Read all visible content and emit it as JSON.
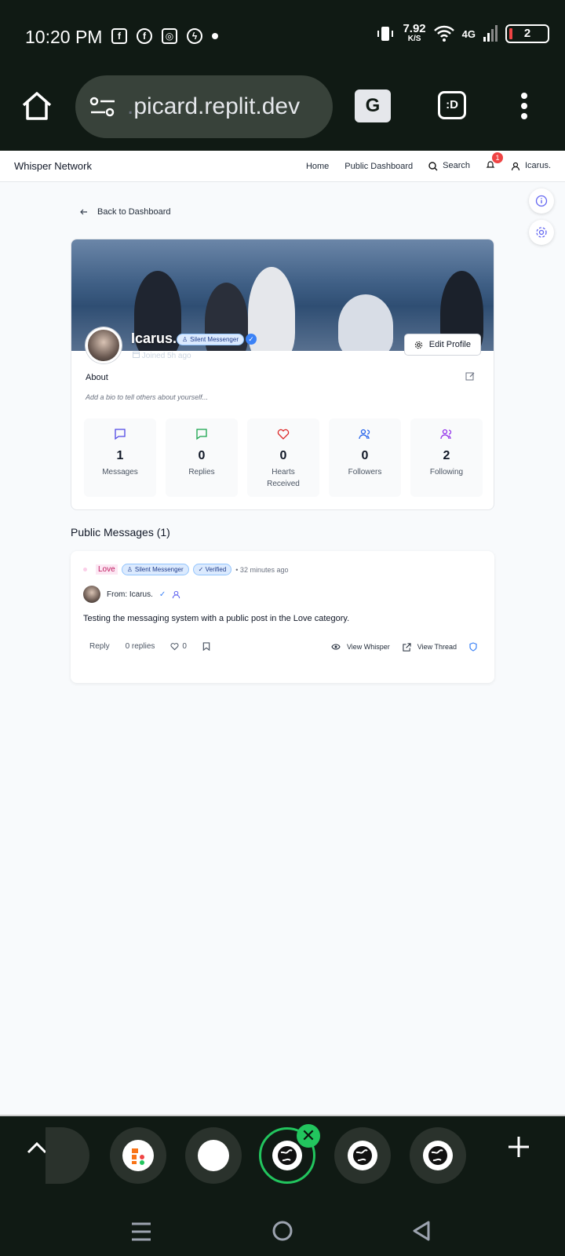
{
  "status_bar": {
    "time": "10:20 PM",
    "speed_value": "7.92",
    "speed_unit": "K/S",
    "network": "4G",
    "battery": "2"
  },
  "browser": {
    "url_prefix": ".",
    "url_domain": "picard.replit.dev",
    "tab_switch_label": ":D"
  },
  "navbar": {
    "brand": "Whisper Network",
    "home": "Home",
    "public_dashboard": "Public Dashboard",
    "search": "Search",
    "notification_count": "1",
    "user": "Icarus."
  },
  "back_link": "Back to Dashboard",
  "profile": {
    "name": "Icarus.",
    "badge": "Silent Messenger",
    "joined": "Joined 5h ago",
    "edit_button": "Edit Profile",
    "about_title": "About",
    "about_placeholder": "Add a bio to tell others about yourself...",
    "stats": [
      {
        "value": "1",
        "label": "Messages",
        "color": "#4f46e5",
        "icon": "message-square-icon"
      },
      {
        "value": "0",
        "label": "Replies",
        "color": "#16a34a",
        "icon": "message-reply-icon"
      },
      {
        "value": "0",
        "label": "Hearts Received",
        "color": "#dc2626",
        "icon": "heart-icon"
      },
      {
        "value": "0",
        "label": "Followers",
        "color": "#2563eb",
        "icon": "users-icon"
      },
      {
        "value": "2",
        "label": "Following",
        "color": "#9333ea",
        "icon": "users-icon"
      }
    ]
  },
  "public_messages": {
    "title": "Public Messages (1)",
    "message": {
      "category": "Love",
      "badge_silent": "Silent Messenger",
      "badge_verified": "✓ Verified",
      "time": "• 32 minutes ago",
      "from": "From: Icarus.",
      "body": "Testing the messaging system with a public post in the Love category.",
      "reply": "Reply",
      "replies_count": "0 replies",
      "hearts": "0",
      "view_whisper": "View Whisper",
      "view_thread": "View Thread"
    }
  },
  "colors": {
    "accent": "#3b82f6",
    "chrome_bg": "#101a14",
    "active_tab": "#22c55e"
  }
}
